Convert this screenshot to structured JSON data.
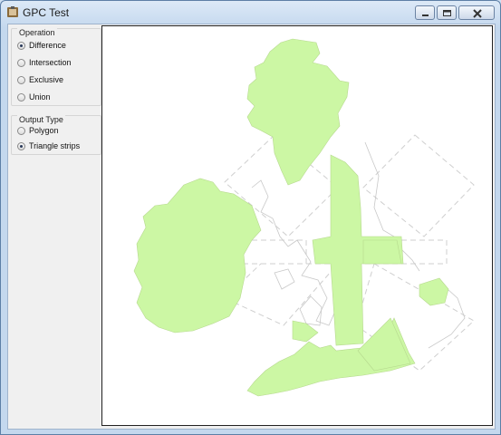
{
  "window": {
    "title": "GPC Test",
    "icons": {
      "app": "gpc-app-icon",
      "minimize": "minimize-icon",
      "maximize": "maximize-icon",
      "close": "close-icon"
    }
  },
  "operation": {
    "title": "Operation",
    "options": [
      "Difference",
      "Intersection",
      "Exclusive",
      "Union"
    ],
    "selected": "Difference"
  },
  "output_type": {
    "title": "Output Type",
    "options": [
      "Polygon",
      "Triangle strips"
    ],
    "selected": "Triangle strips"
  },
  "colors": {
    "fill": "#ccf7a4",
    "outline": "#c8c8c8",
    "canvas_bg": "#ffffff"
  }
}
